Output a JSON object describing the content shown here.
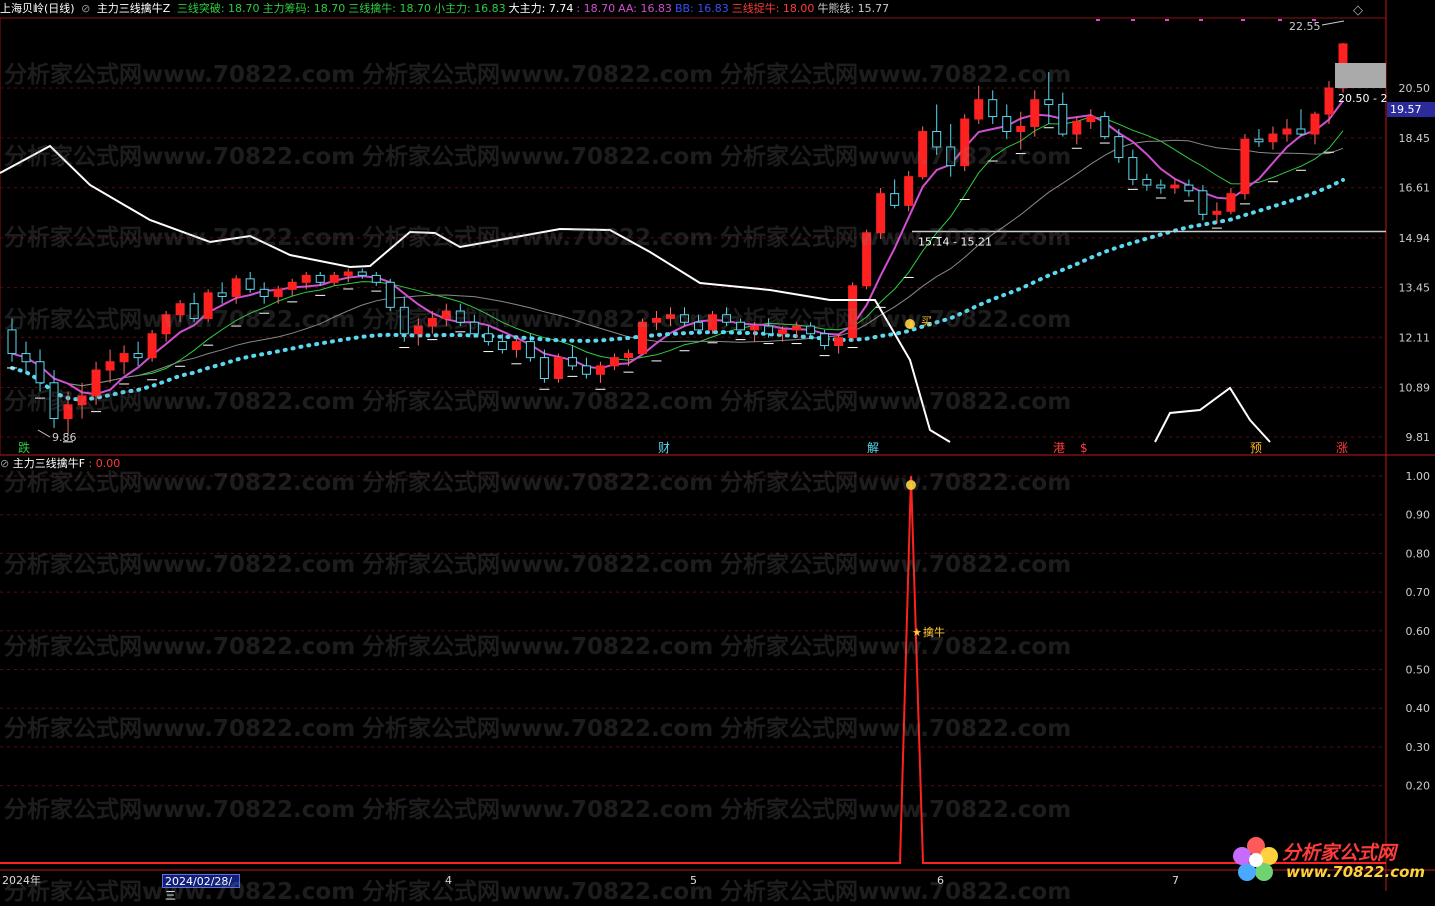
{
  "header": {
    "stock": "上海贝岭(日线)",
    "indicator": "主力三线擒牛Z",
    "items": [
      {
        "label": "三线突破: 18.70",
        "color": "#2ecc40"
      },
      {
        "label": "主力筹码: 18.70",
        "color": "#2ecc40"
      },
      {
        "label": "三线擒牛: 18.70",
        "color": "#2ecc40"
      },
      {
        "label": "小主力: 16.83",
        "color": "#2ecc40"
      },
      {
        "label": "大主力: 7.74",
        "color": "#ffffff"
      },
      {
        "label": ": 18.70",
        "color": "#d14fd1"
      },
      {
        "label": "AA: 16.83",
        "color": "#d14fd1"
      },
      {
        "label": "BB: 16.83",
        "color": "#3a4ff2"
      },
      {
        "label": "三线捉牛: 18.00",
        "color": "#ff3b3b"
      },
      {
        "label": "牛熊线: 15.77",
        "color": "#ccc"
      }
    ]
  },
  "subchart": {
    "indicator": "主力三线擒牛F",
    "value": ": 0.00"
  },
  "footer": {
    "year_label": "2024年",
    "cursor_date": "2024/02/28/三",
    "months": [
      "4",
      "5",
      "6",
      "7"
    ]
  },
  "logo": {
    "line1": "分析家公式网",
    "line2": "www.70822.com"
  },
  "watermark": "分析家公式网www.70822.com",
  "chart_data": {
    "type": "candlestick",
    "y_axis_main": [
      "20.50",
      "18.45",
      "16.61",
      "14.94",
      "13.45",
      "12.11",
      "10.89",
      "9.81"
    ],
    "y_axis_sub": [
      "1.00",
      "0.90",
      "0.80",
      "0.70",
      "0.60",
      "0.50",
      "0.40",
      "0.30",
      "0.20"
    ],
    "price_tag": "19.57",
    "annotations": {
      "high_label": "22.55",
      "low_label": "9.86",
      "range_label": "15.14 - 15.21",
      "range_label_right": "20.50 - 2",
      "buy_label": "买",
      "capture_label": "擒牛"
    },
    "bottom_markers": [
      {
        "label": "跌",
        "color": "#2ecc40"
      },
      {
        "label": "财",
        "color": "#5ad8f0"
      },
      {
        "label": "解",
        "color": "#5ad8f0"
      },
      {
        "label": "港",
        "color": "#ff3b3b"
      },
      {
        "label": "$",
        "color": "#ff3b3b"
      },
      {
        "label": "预",
        "color": "#ffb020"
      },
      {
        "label": "涨",
        "color": "#ff3b3b"
      }
    ],
    "candles": [
      [
        12.3,
        12.6,
        11.5,
        11.7
      ],
      [
        11.7,
        12.0,
        11.2,
        11.5
      ],
      [
        11.5,
        11.8,
        10.8,
        11.0
      ],
      [
        11.0,
        11.3,
        10.0,
        10.2
      ],
      [
        10.2,
        10.8,
        9.86,
        10.5
      ],
      [
        10.5,
        11.0,
        10.2,
        10.7
      ],
      [
        10.7,
        11.5,
        10.5,
        11.3
      ],
      [
        11.3,
        11.8,
        11.0,
        11.5
      ],
      [
        11.5,
        11.9,
        11.2,
        11.7
      ],
      [
        11.7,
        12.0,
        11.4,
        11.6
      ],
      [
        11.6,
        12.3,
        11.5,
        12.2
      ],
      [
        12.2,
        12.8,
        12.0,
        12.7
      ],
      [
        12.7,
        13.1,
        12.5,
        13.0
      ],
      [
        13.0,
        13.3,
        12.5,
        12.6
      ],
      [
        12.6,
        13.4,
        12.5,
        13.3
      ],
      [
        13.3,
        13.6,
        13.0,
        13.2
      ],
      [
        13.2,
        13.8,
        13.0,
        13.7
      ],
      [
        13.7,
        13.9,
        13.3,
        13.4
      ],
      [
        13.4,
        13.6,
        13.0,
        13.2
      ],
      [
        13.2,
        13.5,
        13.0,
        13.4
      ],
      [
        13.4,
        13.7,
        13.2,
        13.6
      ],
      [
        13.6,
        13.9,
        13.4,
        13.8
      ],
      [
        13.8,
        13.9,
        13.5,
        13.6
      ],
      [
        13.6,
        13.9,
        13.5,
        13.8
      ],
      [
        13.8,
        14.0,
        13.6,
        13.9
      ],
      [
        13.9,
        14.0,
        13.7,
        13.8
      ],
      [
        13.8,
        13.9,
        13.5,
        13.6
      ],
      [
        13.6,
        13.7,
        12.8,
        12.9
      ],
      [
        12.9,
        13.2,
        12.0,
        12.2
      ],
      [
        12.2,
        12.6,
        11.9,
        12.4
      ],
      [
        12.4,
        12.8,
        12.2,
        12.6
      ],
      [
        12.6,
        13.0,
        12.4,
        12.8
      ],
      [
        12.8,
        13.0,
        12.4,
        12.5
      ],
      [
        12.5,
        12.7,
        12.1,
        12.2
      ],
      [
        12.2,
        12.4,
        11.9,
        12.0
      ],
      [
        12.0,
        12.2,
        11.7,
        11.8
      ],
      [
        11.8,
        12.1,
        11.6,
        12.0
      ],
      [
        12.0,
        12.2,
        11.5,
        11.6
      ],
      [
        11.6,
        11.8,
        11.0,
        11.1
      ],
      [
        11.1,
        11.7,
        11.0,
        11.6
      ],
      [
        11.6,
        11.9,
        11.3,
        11.4
      ],
      [
        11.4,
        11.6,
        11.1,
        11.2
      ],
      [
        11.2,
        11.5,
        11.0,
        11.4
      ],
      [
        11.4,
        11.7,
        11.3,
        11.6
      ],
      [
        11.6,
        11.8,
        11.4,
        11.7
      ],
      [
        11.7,
        12.6,
        11.7,
        12.5
      ],
      [
        12.5,
        12.8,
        12.3,
        12.6
      ],
      [
        12.6,
        12.9,
        12.4,
        12.7
      ],
      [
        12.7,
        12.9,
        12.4,
        12.5
      ],
      [
        12.5,
        12.7,
        12.2,
        12.3
      ],
      [
        12.3,
        12.8,
        12.2,
        12.7
      ],
      [
        12.7,
        12.9,
        12.4,
        12.5
      ],
      [
        12.5,
        12.6,
        12.2,
        12.3
      ],
      [
        12.3,
        12.5,
        12.0,
        12.4
      ],
      [
        12.4,
        12.6,
        12.1,
        12.2
      ],
      [
        12.2,
        12.4,
        12.0,
        12.3
      ],
      [
        12.3,
        12.5,
        12.1,
        12.4
      ],
      [
        12.4,
        12.5,
        12.1,
        12.2
      ],
      [
        12.2,
        12.3,
        11.8,
        11.9
      ],
      [
        11.9,
        12.2,
        11.7,
        12.1
      ],
      [
        12.1,
        13.6,
        12.0,
        13.5
      ],
      [
        13.5,
        15.2,
        13.4,
        15.1
      ],
      [
        15.1,
        16.6,
        14.9,
        16.4
      ],
      [
        16.4,
        16.9,
        15.9,
        16.0
      ],
      [
        16.0,
        17.2,
        15.8,
        17.0
      ],
      [
        17.0,
        18.9,
        16.9,
        18.7
      ],
      [
        18.7,
        19.8,
        17.8,
        18.1
      ],
      [
        18.1,
        19.0,
        17.0,
        17.4
      ],
      [
        17.4,
        19.4,
        17.2,
        19.2
      ],
      [
        19.2,
        20.6,
        19.0,
        20.0
      ],
      [
        20.0,
        20.4,
        19.0,
        19.3
      ],
      [
        19.3,
        19.8,
        18.4,
        18.7
      ],
      [
        18.7,
        19.5,
        18.0,
        18.9
      ],
      [
        18.9,
        20.4,
        18.5,
        20.0
      ],
      [
        20.0,
        21.2,
        19.0,
        19.8
      ],
      [
        19.8,
        20.3,
        18.5,
        18.6
      ],
      [
        18.6,
        19.3,
        18.2,
        19.1
      ],
      [
        19.1,
        19.6,
        18.8,
        19.3
      ],
      [
        19.3,
        19.5,
        18.4,
        18.5
      ],
      [
        18.5,
        18.8,
        17.5,
        17.7
      ],
      [
        17.7,
        18.0,
        16.7,
        16.9
      ],
      [
        16.9,
        17.1,
        16.5,
        16.7
      ],
      [
        16.7,
        16.9,
        16.4,
        16.6
      ],
      [
        16.6,
        16.9,
        16.4,
        16.7
      ],
      [
        16.7,
        16.9,
        16.3,
        16.5
      ],
      [
        16.5,
        16.7,
        15.5,
        15.7
      ],
      [
        15.7,
        16.1,
        15.4,
        15.8
      ],
      [
        15.8,
        16.6,
        15.7,
        16.4
      ],
      [
        16.4,
        18.6,
        16.2,
        18.4
      ],
      [
        18.4,
        18.8,
        18.1,
        18.3
      ],
      [
        18.3,
        18.9,
        18.0,
        18.6
      ],
      [
        18.6,
        19.2,
        18.3,
        18.8
      ],
      [
        18.8,
        19.6,
        18.5,
        18.6
      ],
      [
        18.6,
        19.5,
        18.2,
        19.4
      ],
      [
        19.4,
        20.8,
        19.0,
        20.5
      ],
      [
        20.5,
        22.55,
        20.3,
        22.5
      ]
    ]
  }
}
